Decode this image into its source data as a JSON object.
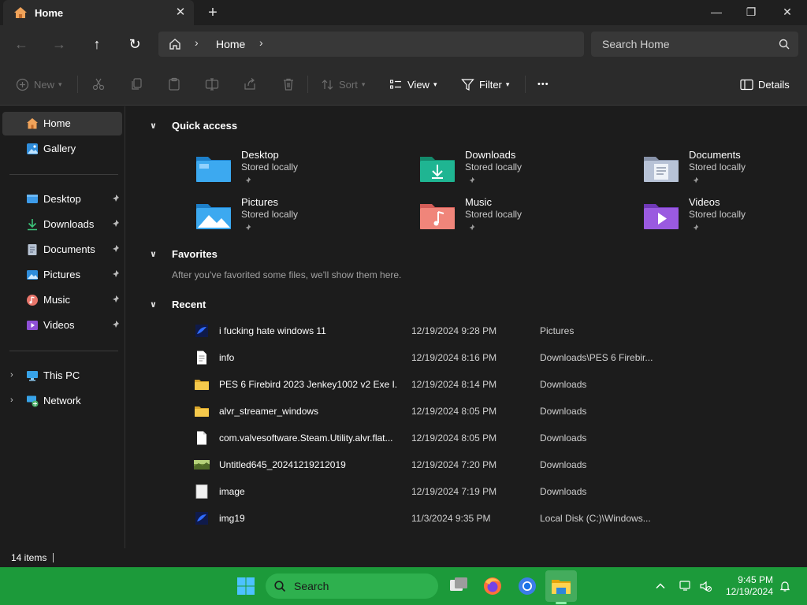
{
  "window": {
    "tab_title": "Home",
    "close_tab": "✕",
    "new_tab": "+",
    "minimize": "—",
    "maximize": "❐",
    "close": "✕"
  },
  "navigation": {
    "back": "←",
    "forward": "→",
    "up": "↑",
    "refresh": "↻",
    "breadcrumb": "Home",
    "search_placeholder": "Search Home"
  },
  "commands": {
    "new": "New",
    "sort": "Sort",
    "view": "View",
    "filter": "Filter",
    "more": "•••",
    "details": "Details"
  },
  "sidebar": {
    "home": "Home",
    "gallery": "Gallery",
    "pinned": [
      "Desktop",
      "Downloads",
      "Documents",
      "Pictures",
      "Music",
      "Videos"
    ],
    "this_pc": "This PC",
    "network": "Network"
  },
  "quick_access": {
    "header": "Quick access",
    "items": [
      {
        "name": "Desktop",
        "status": "Stored locally"
      },
      {
        "name": "Downloads",
        "status": "Stored locally"
      },
      {
        "name": "Documents",
        "status": "Stored locally"
      },
      {
        "name": "Pictures",
        "status": "Stored locally"
      },
      {
        "name": "Music",
        "status": "Stored locally"
      },
      {
        "name": "Videos",
        "status": "Stored locally"
      }
    ]
  },
  "favorites": {
    "header": "Favorites",
    "empty_message": "After you've favorited some files, we'll show them here."
  },
  "recent": {
    "header": "Recent",
    "rows": [
      {
        "name": "i fucking hate windows 11",
        "date": "12/19/2024 9:28 PM",
        "location": "Pictures",
        "icon": "image-file-icon"
      },
      {
        "name": "info",
        "date": "12/19/2024 8:16 PM",
        "location": "Downloads\\PES 6 Firebir...",
        "icon": "text-file-icon"
      },
      {
        "name": "PES 6 Firebird 2023 Jenkey1002 v2 Exe I...",
        "date": "12/19/2024 8:14 PM",
        "location": "Downloads",
        "icon": "folder-icon"
      },
      {
        "name": "alvr_streamer_windows",
        "date": "12/19/2024 8:05 PM",
        "location": "Downloads",
        "icon": "folder-icon"
      },
      {
        "name": "com.valvesoftware.Steam.Utility.alvr.flat...",
        "date": "12/19/2024 8:05 PM",
        "location": "Downloads",
        "icon": "blank-file-icon"
      },
      {
        "name": "Untitled645_20241219212019",
        "date": "12/19/2024 7:20 PM",
        "location": "Downloads",
        "icon": "landscape-image-icon"
      },
      {
        "name": "image",
        "date": "12/19/2024 7:19 PM",
        "location": "Downloads",
        "icon": "blank-image-icon"
      },
      {
        "name": "img19",
        "date": "11/3/2024 9:35 PM",
        "location": "Local Disk (C:)\\Windows...",
        "icon": "image-file-icon"
      }
    ]
  },
  "status": {
    "item_count": "14 items"
  },
  "taskbar": {
    "search_label": "Search",
    "time": "9:45 PM",
    "date": "12/19/2024",
    "accent": "#1c9a3a"
  }
}
